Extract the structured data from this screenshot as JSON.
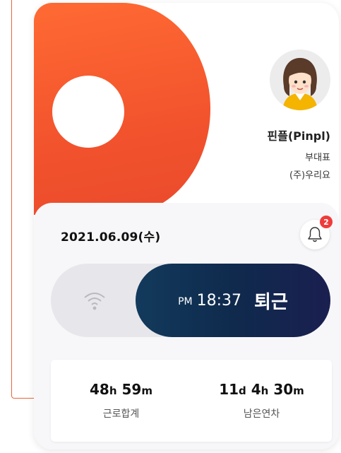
{
  "profile": {
    "name": "핀플(Pinpl)",
    "role": "부대표",
    "company": "(주)우리요"
  },
  "notifications": {
    "badge_count": "2"
  },
  "date": "2021.06.09(수)",
  "commute": {
    "period": "PM",
    "time": "18:37",
    "status": "퇴근"
  },
  "stats": {
    "work_total": {
      "hours": "48",
      "h_unit": "h",
      "minutes": "59",
      "m_unit": "m",
      "label": "근로합계"
    },
    "remaining_leave": {
      "days": "11",
      "d_unit": "d",
      "hours": "4",
      "h_unit": "h",
      "minutes": "30",
      "m_unit": "m",
      "label": "남은연차"
    }
  },
  "colors": {
    "brand": "#f2532d",
    "knob_dark": "#0f2a4d",
    "badge": "#f03b3b"
  },
  "icons": {
    "notification": "bell-icon",
    "network": "wifi-icon"
  }
}
